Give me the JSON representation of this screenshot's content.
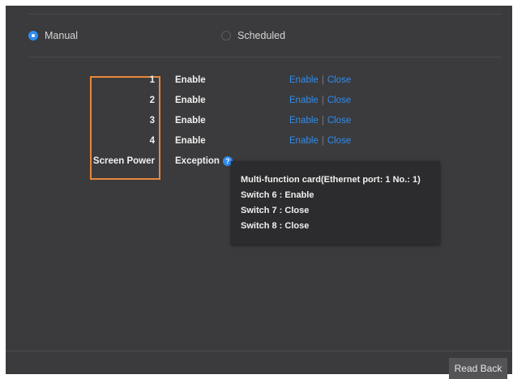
{
  "mode": {
    "manual_label": "Manual",
    "scheduled_label": "Scheduled",
    "selected": "Manual"
  },
  "rows": [
    {
      "label": "1",
      "status": "Enable",
      "enable_action": "Enable",
      "close_action": "Close"
    },
    {
      "label": "2",
      "status": "Enable",
      "enable_action": "Enable",
      "close_action": "Close"
    },
    {
      "label": "3",
      "status": "Enable",
      "enable_action": "Enable",
      "close_action": "Close"
    },
    {
      "label": "4",
      "status": "Enable",
      "enable_action": "Enable",
      "close_action": "Close"
    },
    {
      "label": "Screen Power",
      "status": "Exception"
    }
  ],
  "tooltip": {
    "line1": "Multi-function card(Ethernet port:  1 No.:  1)",
    "line2": "Switch 6 : Enable",
    "line3": "Switch 7 : Close",
    "line4": "Switch 8 : Close"
  },
  "help_icon": "question-mark-icon",
  "footer": {
    "read_back_label": "Read Back"
  },
  "colors": {
    "background": "#3b3b3d",
    "accent": "#2f8cf0",
    "highlight": "#e8873a",
    "text": "#f0f0f0"
  }
}
